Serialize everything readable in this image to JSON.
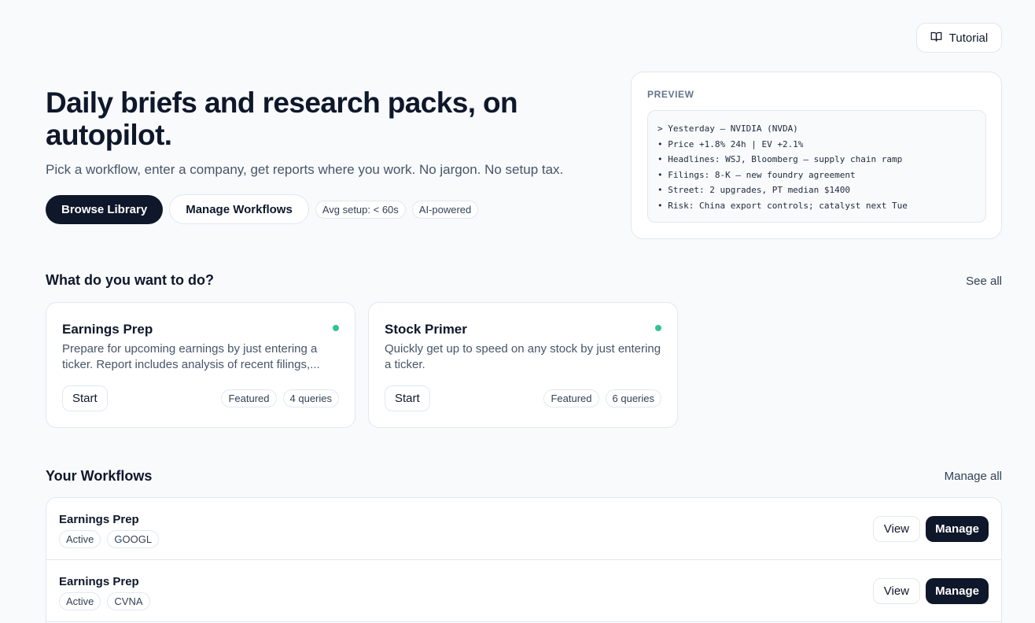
{
  "header": {
    "tutorial_label": "Tutorial",
    "tutorial_icon": "book-open-icon"
  },
  "hero": {
    "title": "Daily briefs and research packs, on autopilot.",
    "subtitle": "Pick a workflow, enter a company, get reports where you work. No jargon. No setup tax.",
    "browse_label": "Browse Library",
    "manage_label": "Manage Workflows",
    "chips": [
      "Avg setup: < 60s",
      "AI-powered"
    ]
  },
  "preview": {
    "label": "PREVIEW",
    "lines": [
      "> Yesterday — NVIDIA (NVDA)",
      "• Price +1.8% 24h | EV +2.1%",
      "• Headlines: WSJ, Bloomberg — supply chain ramp",
      "• Filings: 8-K — new foundry agreement",
      "• Street: 2 upgrades, PT median $1400",
      "• Risk: China export controls; catalyst next Tue"
    ]
  },
  "todo": {
    "title": "What do you want to do?",
    "see_all": "See all",
    "cards": [
      {
        "name": "Earnings Prep",
        "desc": "Prepare for upcoming earnings by just entering a ticker. Report includes analysis of recent filings,...",
        "start": "Start",
        "tag1": "Featured",
        "tag2": "4 queries",
        "status_color": "#34c38f"
      },
      {
        "name": "Stock Primer",
        "desc": "Quickly get up to speed on any stock by just entering a ticker.",
        "start": "Start",
        "tag1": "Featured",
        "tag2": "6 queries",
        "status_color": "#34c38f"
      }
    ]
  },
  "workflows": {
    "title": "Your Workflows",
    "manage_all": "Manage all",
    "rows": [
      {
        "name": "Earnings Prep",
        "status": "Active",
        "ticker": "GOOGL",
        "view": "View",
        "manage": "Manage"
      },
      {
        "name": "Earnings Prep",
        "status": "Active",
        "ticker": "CVNA",
        "view": "View",
        "manage": "Manage"
      }
    ]
  },
  "colors": {
    "primary": "#0f172a",
    "accent_green": "#34c38f",
    "border": "#e2e8f0",
    "background": "#f8fafc"
  }
}
